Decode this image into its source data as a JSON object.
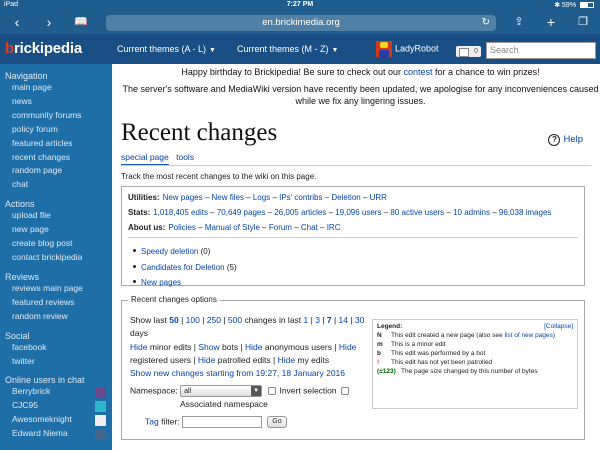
{
  "status_bar": {
    "device": "iPad",
    "time": "7:27 PM",
    "battery": "59%",
    "battery_level": 0.59
  },
  "browser": {
    "url": "en.brickimedia.org"
  },
  "site": {
    "logo": "brickipedia",
    "nav_tabs": [
      "Current themes (A - L)",
      "Current themes (M - Z)"
    ],
    "user": "LadyRobot",
    "notifications": "0",
    "search_placeholder": "Search"
  },
  "sidebar": {
    "sections": [
      {
        "heading": "Navigation",
        "items": [
          "main page",
          "news",
          "community forums",
          "policy forum",
          "featured articles",
          "recent changes",
          "random page",
          "chat"
        ]
      },
      {
        "heading": "Actions",
        "items": [
          "upload file",
          "new page",
          "create blog post",
          "contact brickipedia"
        ]
      },
      {
        "heading": "Reviews",
        "items": [
          "reviews main page",
          "featured reviews",
          "random review"
        ]
      },
      {
        "heading": "Social",
        "items": [
          "facebook",
          "twitter"
        ]
      }
    ],
    "online_heading": "Online users in chat",
    "online_users": [
      {
        "name": "Berrybrick",
        "color": "#6b4a8a"
      },
      {
        "name": "CJC95",
        "color": "#2ab7c9"
      },
      {
        "name": "Awesomeknight",
        "color": "#eeeeee"
      },
      {
        "name": "Edward Niema",
        "color": "#446688"
      }
    ]
  },
  "notice": {
    "line1_pre": "Happy birthday to Brickipedia! Be sure to check out our ",
    "line1_link": "contest",
    "line1_post": " for a chance to win prizes!",
    "line2": "The server's software and MediaWiki version have recently been updated, we apologise for any inconveniences caused while we fix any lingering issues."
  },
  "page": {
    "title": "Recent changes",
    "help": "Help",
    "tabs": [
      "special page",
      "tools"
    ],
    "description": "Track the most recent changes to the wiki on this page."
  },
  "utilities": {
    "utilities_label": "Utilities:",
    "utilities_links": [
      "New pages",
      "New files",
      "Logs",
      "IPs' contribs",
      "Deletion",
      "URR"
    ],
    "stats_label": "Stats:",
    "stats_links": [
      "1,018,405 edits",
      "70,649 pages",
      "26,005 articles",
      "19,096 users",
      "80 active users",
      "10 admins",
      "96,038 images"
    ],
    "about_label": "About us:",
    "about_links": [
      "Policies",
      "Manual of Style",
      "Forum",
      "Chat",
      "IRC"
    ],
    "queues": [
      {
        "label": "Speedy deletion",
        "count": "(0)"
      },
      {
        "label": "Candidates for Deletion",
        "count": "(5)"
      },
      {
        "label": "New pages",
        "count": ""
      }
    ]
  },
  "rc_options": {
    "legend_title": "Recent changes options",
    "show_last": "Show last",
    "counts": [
      "50",
      "100",
      "250",
      "500"
    ],
    "changes_in_last": "changes in last",
    "days_values": [
      "1",
      "3",
      "7",
      "14",
      "30"
    ],
    "days_word": "days",
    "hide_minor": "Hide",
    "minor_edits": "minor edits",
    "show_bots": "Show",
    "bots": "bots",
    "hide_anon": "Hide",
    "anonymous_users": "anonymous users",
    "hide_registered": "Hide",
    "registered_users": "registered users",
    "hide_patrolled": "Hide",
    "patrolled_edits": "patrolled edits",
    "hide_my": "Hide",
    "my_edits": "my edits",
    "show_new": "Show new changes starting from 19:27, 18 January 2016",
    "namespace_label": "Namespace:",
    "namespace_value": "all",
    "invert_selection": "Invert selection",
    "associated_namespace": "Associated namespace",
    "tag_filter_label": "Tag",
    "tag_filter_label2": "filter:",
    "go": "Go"
  },
  "legend": {
    "title": "Legend:",
    "collapse": "[Collapse]",
    "rows": [
      {
        "key": "N",
        "text_pre": "This edit created a new page (also see ",
        "link": "list of new pages",
        "text_post": ")",
        "style": ""
      },
      {
        "key": "m",
        "text_pre": "This is a minor edit",
        "link": "",
        "text_post": "",
        "style": ""
      },
      {
        "key": "b",
        "text_pre": "This edit was performed by a bot",
        "link": "",
        "text_post": "",
        "style": ""
      },
      {
        "key": "!",
        "text_pre": "This edit has not yet been patrolled",
        "link": "",
        "text_post": "",
        "style": "red"
      },
      {
        "key": "(±123)",
        "text_pre": "The page size changed by this number of bytes",
        "link": "",
        "text_post": "",
        "style": "green"
      }
    ]
  }
}
